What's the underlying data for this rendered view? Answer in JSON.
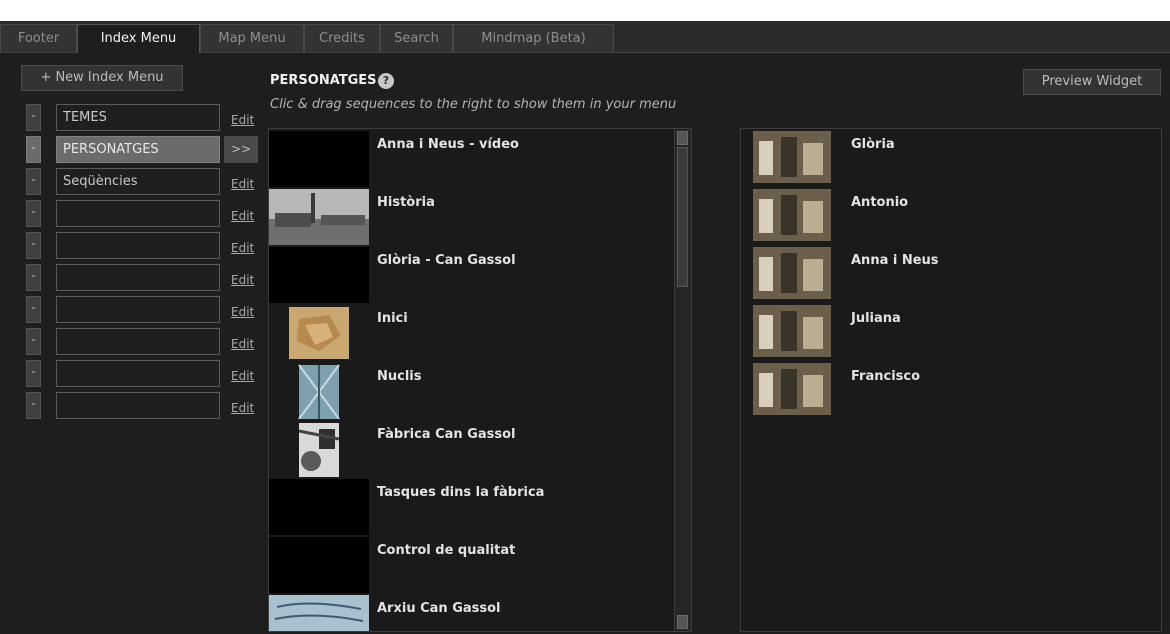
{
  "tabs": [
    {
      "label": "Footer",
      "active": false
    },
    {
      "label": "Index Menu",
      "active": true
    },
    {
      "label": "Map Menu",
      "active": false
    },
    {
      "label": "Credits",
      "active": false
    },
    {
      "label": "Search",
      "active": false
    },
    {
      "label": "Mindmap (Beta)",
      "active": false
    }
  ],
  "left": {
    "new_button": "+ New Index Menu",
    "minus_glyph": "-",
    "edit_label": "Edit",
    "arrow_label": ">>",
    "menus": [
      {
        "value": "TEMES",
        "selected": false
      },
      {
        "value": "PERSONATGES",
        "selected": true
      },
      {
        "value": "Seqüències",
        "selected": false
      },
      {
        "value": "",
        "selected": false
      },
      {
        "value": "",
        "selected": false
      },
      {
        "value": "",
        "selected": false
      },
      {
        "value": "",
        "selected": false
      },
      {
        "value": "",
        "selected": false
      },
      {
        "value": "",
        "selected": false
      },
      {
        "value": "",
        "selected": false
      }
    ]
  },
  "section": {
    "title": "PERSONATGES",
    "help_glyph": "?",
    "hint": "Clic & drag sequences to the right to show them in your menu",
    "preview_button": "Preview Widget"
  },
  "sequences": [
    {
      "label": "Anna i Neus - vídeo",
      "thumb": "black-thumbnail"
    },
    {
      "label": "Història",
      "thumb": "factory-photo-thumbnail"
    },
    {
      "label": "Glòria - Can Gassol",
      "thumb": "black-thumbnail"
    },
    {
      "label": "Inici",
      "thumb": "old-map-thumbnail"
    },
    {
      "label": "Nuclis",
      "thumb": "glass-building-thumbnail"
    },
    {
      "label": "Fàbrica Can Gassol",
      "thumb": "machinery-thumbnail"
    },
    {
      "label": "Tasques dins la fàbrica",
      "thumb": "black-thumbnail"
    },
    {
      "label": "Control de qualitat",
      "thumb": "black-thumbnail"
    },
    {
      "label": "Arxiu Can Gassol",
      "thumb": "document-thumbnail"
    }
  ],
  "selected_items": [
    {
      "label": "Glòria"
    },
    {
      "label": "Antonio"
    },
    {
      "label": "Anna i Neus"
    },
    {
      "label": "Juliana"
    },
    {
      "label": "Francisco"
    }
  ],
  "colors": {
    "background": "#1e1e1e",
    "selected": "#6b6b6b",
    "panel": "#1a1a1a"
  }
}
